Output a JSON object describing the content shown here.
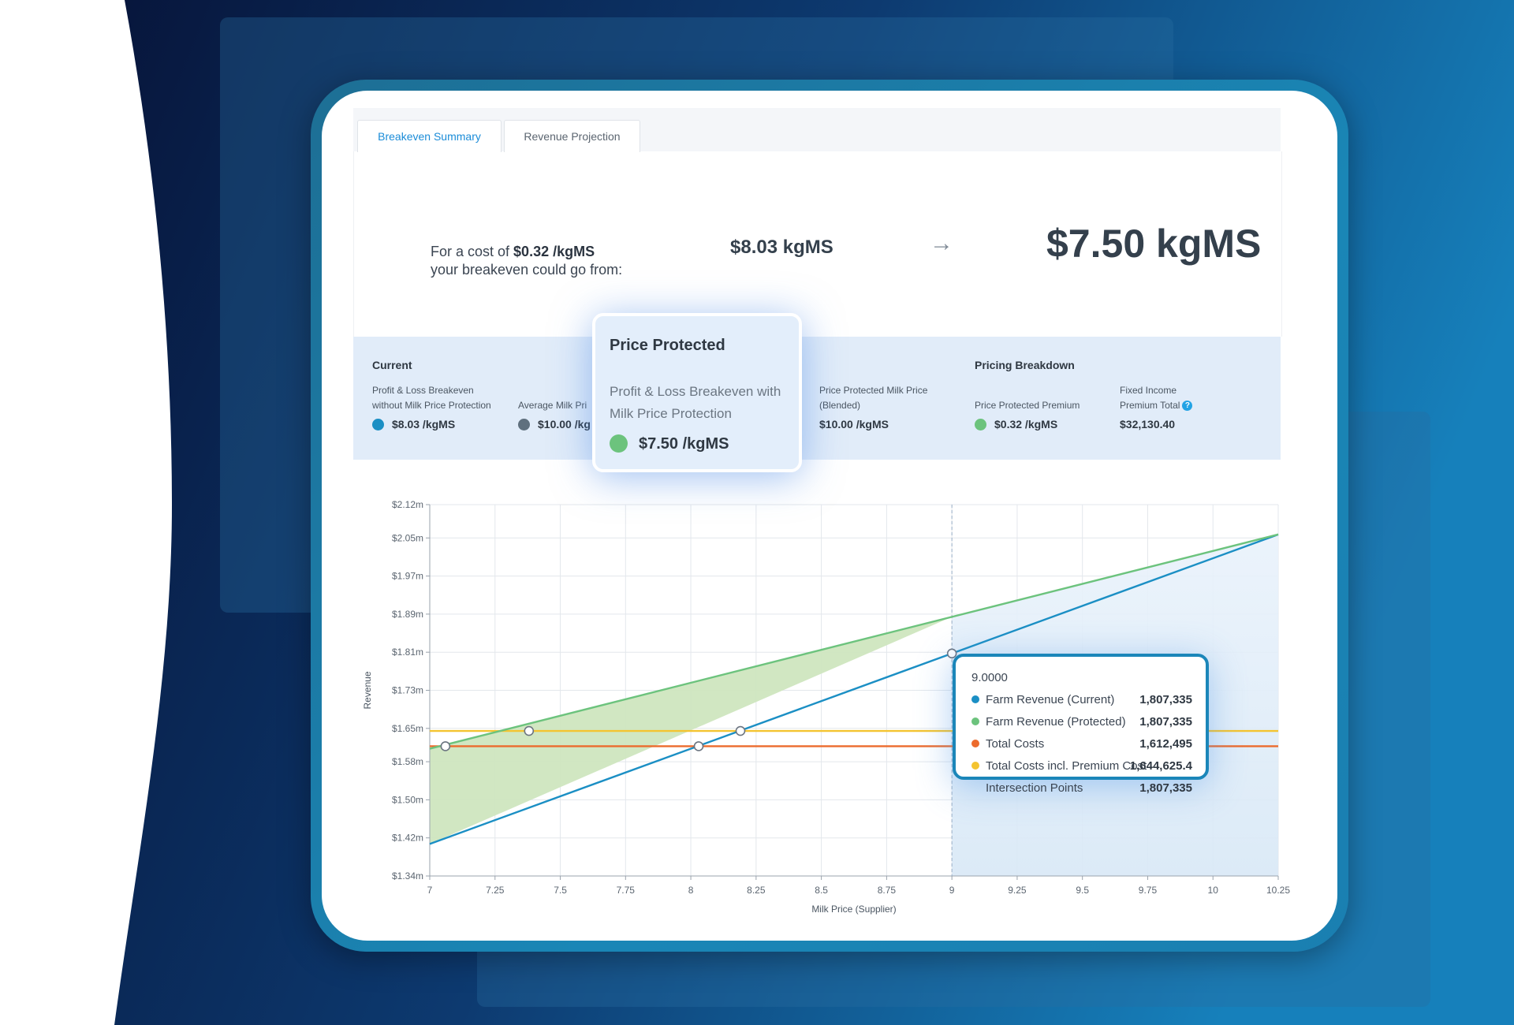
{
  "tabs": [
    {
      "label": "Breakeven Summary",
      "active": true
    },
    {
      "label": "Revenue Projection",
      "active": false
    }
  ],
  "summary": {
    "cost_prefix": "For a cost of ",
    "cost_value": "$0.32 /kgMS",
    "line2": "your breakeven could go from:",
    "from_value": "$8.03 kgMS",
    "arrow": "→",
    "to_value": "$7.50 kgMS"
  },
  "current": {
    "heading": "Current",
    "pl_label_1": "Profit & Loss Breakeven",
    "pl_label_2": "without Milk Price Protection",
    "pl_value": "$8.03 /kgMS",
    "avg_label": "Average Milk Pri",
    "avg_value": "$10.00 /kg"
  },
  "protected_col": {
    "label_1": "Price Protected Milk Price",
    "label_2": "(Blended)",
    "value": "$10.00 /kgMS"
  },
  "pricing": {
    "heading": "Pricing Breakdown",
    "premium_label": "Price Protected Premium",
    "premium_value": "$0.32 /kgMS",
    "fixed_label_1": "Fixed Income",
    "fixed_label_2": "Premium Total",
    "help_glyph": "?",
    "fixed_value": "$32,130.40"
  },
  "popup": {
    "title": "Price Protected",
    "desc": "Profit & Loss Breakeven with Milk Price Protection",
    "value": "$7.50 /kgMS"
  },
  "colors": {
    "current": "#1b8fc4",
    "protected": "#6cc37d",
    "costs": "#ec6b2d",
    "costs_premium": "#f4c430",
    "avg": "#5f707e"
  },
  "chart_data": {
    "type": "line",
    "xlabel": "Milk Price (Supplier)",
    "ylabel": "Revenue",
    "xlim": [
      7,
      10.25
    ],
    "ylim": [
      1340000,
      2120000
    ],
    "x_ticks": [
      7,
      7.25,
      7.5,
      7.75,
      8,
      8.25,
      8.5,
      8.75,
      9,
      9.25,
      9.5,
      9.75,
      10,
      10.25
    ],
    "x_tick_labels": [
      "7",
      "7.25",
      "7.5",
      "7.75",
      "8",
      "8.25",
      "8.5",
      "8.75",
      "9",
      "9.25",
      "9.5",
      "9.75",
      "10",
      "10.25"
    ],
    "y_ticks": [
      1340000,
      1420000,
      1500000,
      1580000,
      1650000,
      1730000,
      1810000,
      1890000,
      1970000,
      2050000,
      2120000
    ],
    "y_tick_labels": [
      "$1.34m",
      "$1.42m",
      "$1.50m",
      "$1.58m",
      "$1.65m",
      "$1.73m",
      "$1.81m",
      "$1.89m",
      "$1.97m",
      "$2.05m",
      "$2.12m"
    ],
    "grid": true,
    "series": [
      {
        "name": "Farm Revenue (Current)",
        "color": "#1b8fc4",
        "x": [
          7,
          10.25
        ],
        "y": [
          1407335,
          2057335
        ]
      },
      {
        "name": "Farm Revenue (Protected)",
        "color": "#6cc37d",
        "x": [
          7,
          10.25
        ],
        "y": [
          1607335,
          2057335
        ]
      },
      {
        "name": "Total Costs",
        "color": "#ec6b2d",
        "x": [
          7,
          10.25
        ],
        "y": [
          1612495,
          1612495
        ]
      },
      {
        "name": "Total Costs incl. Premium Cost",
        "color": "#f4c430",
        "x": [
          7,
          10.25
        ],
        "y": [
          1644625.4,
          1644625.4
        ]
      }
    ],
    "intersections": [
      {
        "x": 7.06,
        "y": 1612495
      },
      {
        "x": 7.38,
        "y": 1644625.4
      },
      {
        "x": 8.03,
        "y": 1612495
      },
      {
        "x": 8.19,
        "y": 1644625.4
      },
      {
        "x": 9.0,
        "y": 1807335
      }
    ],
    "hover_x": 9,
    "tooltip": {
      "header": "9.0000",
      "rows": [
        {
          "name": "Farm Revenue (Current)",
          "value": "1,807,335",
          "color": "#1b8fc4"
        },
        {
          "name": "Farm Revenue (Protected)",
          "value": "1,807,335",
          "color": "#6cc37d"
        },
        {
          "name": "Total Costs",
          "value": "1,612,495",
          "color": "#ec6b2d"
        },
        {
          "name": "Total Costs incl. Premium Cost",
          "value": "1,644,625.4",
          "color": "#f4c430"
        },
        {
          "name": "Intersection Points",
          "value": "1,807,335",
          "color": ""
        }
      ]
    }
  }
}
